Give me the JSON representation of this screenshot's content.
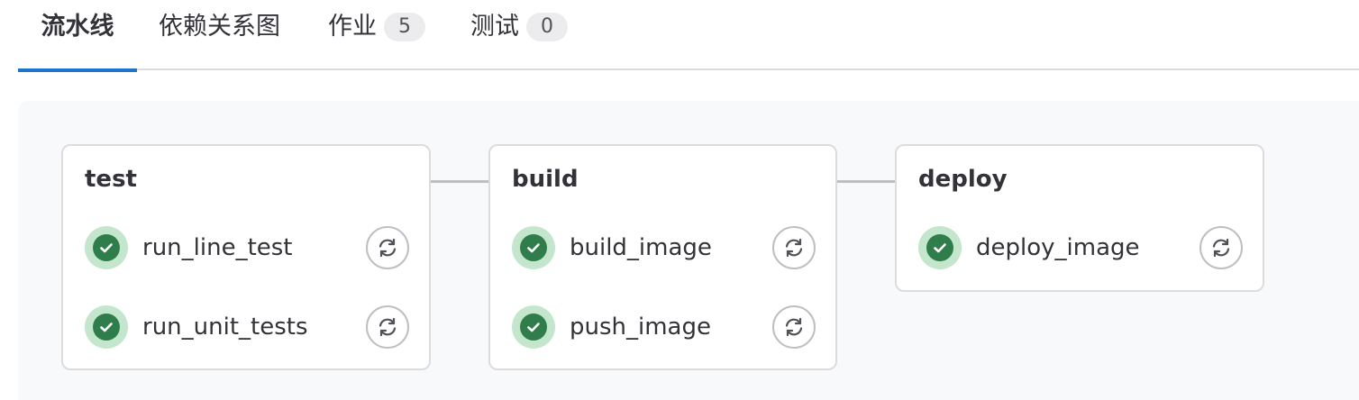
{
  "tabs": {
    "pipeline": {
      "label": "流水线"
    },
    "dependencies": {
      "label": "依赖关系图"
    },
    "jobs": {
      "label": "作业",
      "count": "5"
    },
    "tests": {
      "label": "测试",
      "count": "0"
    }
  },
  "stages": [
    {
      "name": "test",
      "jobs": [
        {
          "name": "run_line_test",
          "status": "success"
        },
        {
          "name": "run_unit_tests",
          "status": "success"
        }
      ]
    },
    {
      "name": "build",
      "jobs": [
        {
          "name": "build_image",
          "status": "success"
        },
        {
          "name": "push_image",
          "status": "success"
        }
      ]
    },
    {
      "name": "deploy",
      "jobs": [
        {
          "name": "deploy_image",
          "status": "success"
        }
      ]
    }
  ],
  "icons": {
    "status": "check-circle-icon",
    "retry": "retry-icon"
  },
  "colors": {
    "active_tab_underline": "#1f75cb",
    "success": "#2e7d4a",
    "success_halo": "#c3e6cd"
  }
}
